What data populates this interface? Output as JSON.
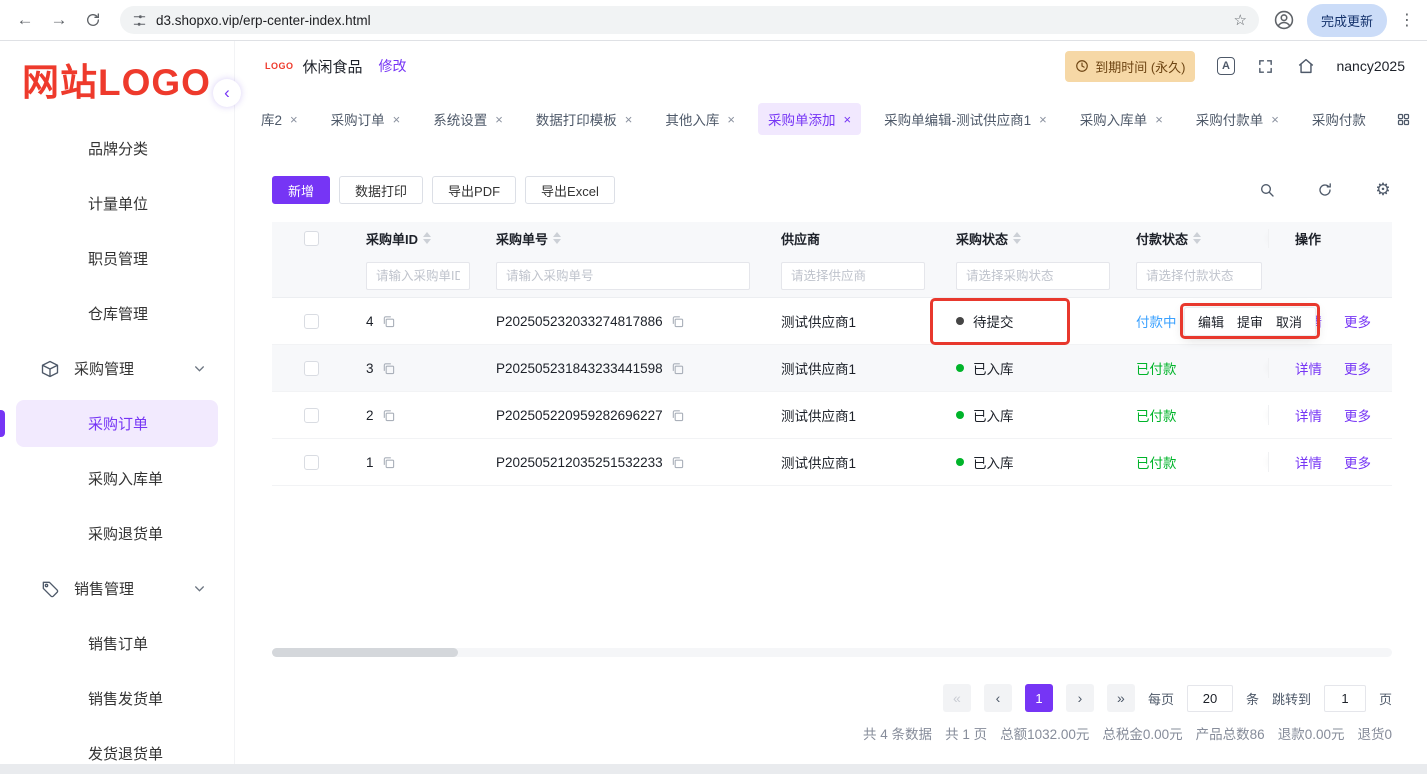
{
  "colors": {
    "primary": "#7635f5",
    "green": "#00b42a",
    "blue": "#3aa1ff",
    "annotation_red": "#e8382d",
    "logo_red": "#ee3a2c",
    "badge_bg": "#f6d8a6"
  },
  "icons": {
    "close": "×",
    "star": "☆",
    "back": "←",
    "forward": "→",
    "menu_dots": "⋮",
    "gear": "⚙",
    "collapse": "‹"
  },
  "browser": {
    "url": "d3.shopxo.vip/erp-center-index.html",
    "update_button": "完成更新"
  },
  "sidebar": {
    "logo": "网站LOGO",
    "items": [
      {
        "label": "品牌分类"
      },
      {
        "label": "计量单位"
      },
      {
        "label": "职员管理"
      },
      {
        "label": "仓库管理"
      },
      {
        "label": "采购管理"
      },
      {
        "label": "采购订单"
      },
      {
        "label": "采购入库单"
      },
      {
        "label": "采购退货单"
      },
      {
        "label": "销售管理"
      },
      {
        "label": "销售订单"
      },
      {
        "label": "销售发货单"
      },
      {
        "label": "发货退货单"
      }
    ]
  },
  "topbar": {
    "logo_text": "LOGO",
    "shop_name": "休闲食品",
    "edit_link": "修改",
    "expire_badge": "到期时间 (永久)",
    "username": "nancy2025"
  },
  "tabs": [
    {
      "label": "库2"
    },
    {
      "label": "采购订单"
    },
    {
      "label": "系统设置"
    },
    {
      "label": "数据打印模板"
    },
    {
      "label": "其他入库"
    },
    {
      "label": "采购单添加"
    },
    {
      "label": "采购单编辑-测试供应商1"
    },
    {
      "label": "采购入库单"
    },
    {
      "label": "采购付款单"
    },
    {
      "label": "采购付款"
    }
  ],
  "toolbar": {
    "add": "新增",
    "print": "数据打印",
    "export_pdf": "导出PDF",
    "export_excel": "导出Excel"
  },
  "table": {
    "columns": {
      "id": "采购单ID",
      "order_no": "采购单号",
      "supplier": "供应商",
      "purchase_status": "采购状态",
      "payment_status": "付款状态",
      "actions": "操作"
    },
    "filters": {
      "id_placeholder": "请输入采购单ID",
      "order_no_placeholder": "请输入采购单号",
      "supplier_placeholder": "请选择供应商",
      "purchase_status_placeholder": "请选择采购状态",
      "payment_status_placeholder": "请选择付款状态"
    },
    "rows": [
      {
        "id": "4",
        "order_no": "P202505232033274817886",
        "supplier": "测试供应商1",
        "purchase_status": "待提交",
        "payment_status": "付款中",
        "detail": "详情",
        "more": "更多"
      },
      {
        "id": "3",
        "order_no": "P202505231843233441598",
        "supplier": "测试供应商1",
        "purchase_status": "已入库",
        "payment_status": "已付款",
        "detail": "详情",
        "more": "更多"
      },
      {
        "id": "2",
        "order_no": "P202505220959282696227",
        "supplier": "测试供应商1",
        "purchase_status": "已入库",
        "payment_status": "已付款",
        "detail": "详情",
        "more": "更多"
      },
      {
        "id": "1",
        "order_no": "P202505212035251532233",
        "supplier": "测试供应商1",
        "purchase_status": "已入库",
        "payment_status": "已付款",
        "detail": "详情",
        "more": "更多"
      }
    ]
  },
  "popup": {
    "items": [
      "编辑",
      "提审",
      "取消"
    ]
  },
  "pagination": {
    "nav": {
      "first": "«",
      "prev": "‹",
      "next": "›",
      "last": "»"
    },
    "page": "1",
    "per_page_label": "每页",
    "per_page": "20",
    "per_page_unit": "条",
    "jump_label": "跳转到",
    "jump_value": "1",
    "jump_unit": "页"
  },
  "summary": [
    "共 4 条数据",
    "共 1 页",
    "总额1032.00元",
    "总税金0.00元",
    "产品总数86",
    "退款0.00元",
    "退货0"
  ]
}
